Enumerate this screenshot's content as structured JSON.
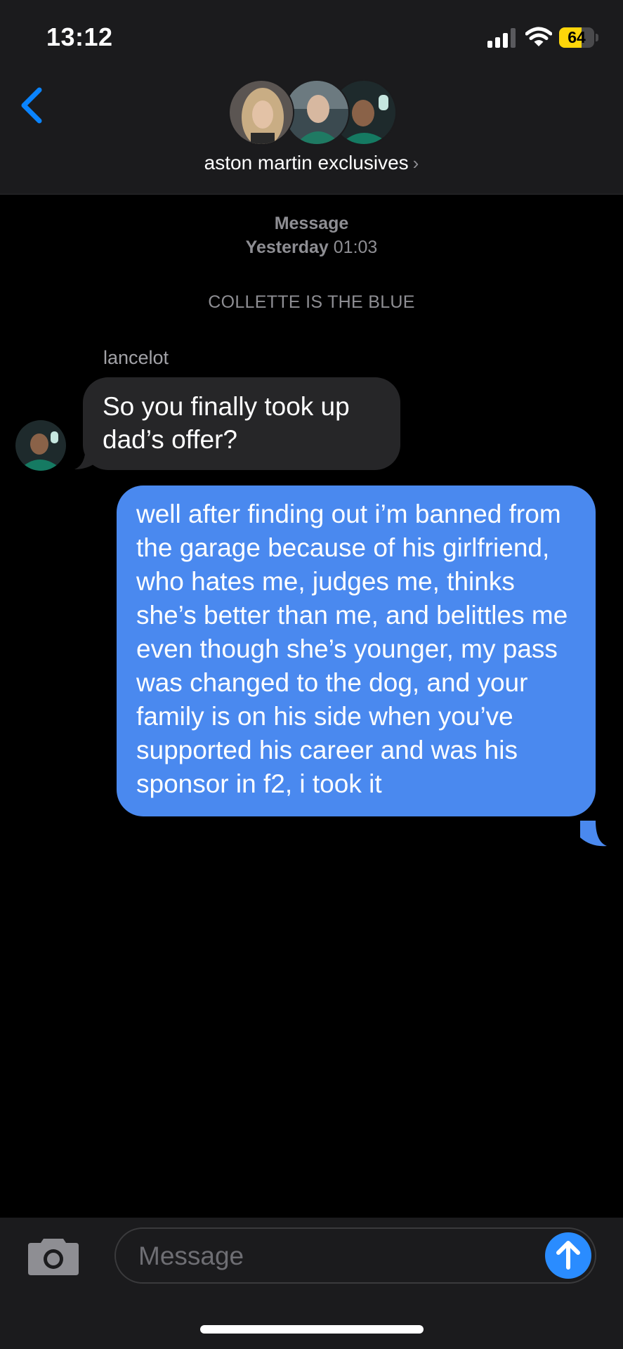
{
  "status_bar": {
    "time": "13:12",
    "battery_level": "64",
    "icons": [
      "cellular-signal-icon",
      "wifi-icon",
      "battery-icon"
    ]
  },
  "header": {
    "back_icon": "chevron-left-icon",
    "group_name": "aston martin exclusives",
    "group_chevron": "›",
    "avatars": [
      "member-avatar-1",
      "member-avatar-2",
      "member-avatar-3"
    ]
  },
  "conversation": {
    "service_label": "Message",
    "day_label": "Yesterday",
    "time_label": "01:03",
    "system_note": "COLLETTE IS THE BLUE",
    "messages": [
      {
        "direction": "incoming",
        "sender": "lancelot",
        "text": "So you finally took up dad’s offer?"
      },
      {
        "direction": "outgoing",
        "text": "well after finding out i’m banned from the garage because of his girlfriend, who hates me, judges me, thinks she’s better than me, and belittles me even though she’s younger, my pass was changed to the dog, and your family is on his side when you’ve supported his career and was his sponsor in f2, i took it"
      }
    ]
  },
  "compose": {
    "placeholder": "Message",
    "camera_icon": "camera-icon",
    "send_icon": "arrow-up-icon"
  },
  "colors": {
    "accent": "#2a8cff",
    "outgoing_bubble": "#4a89ef",
    "incoming_bubble": "#262628",
    "header_bg": "#1b1b1d",
    "battery": "#ffd60a"
  }
}
